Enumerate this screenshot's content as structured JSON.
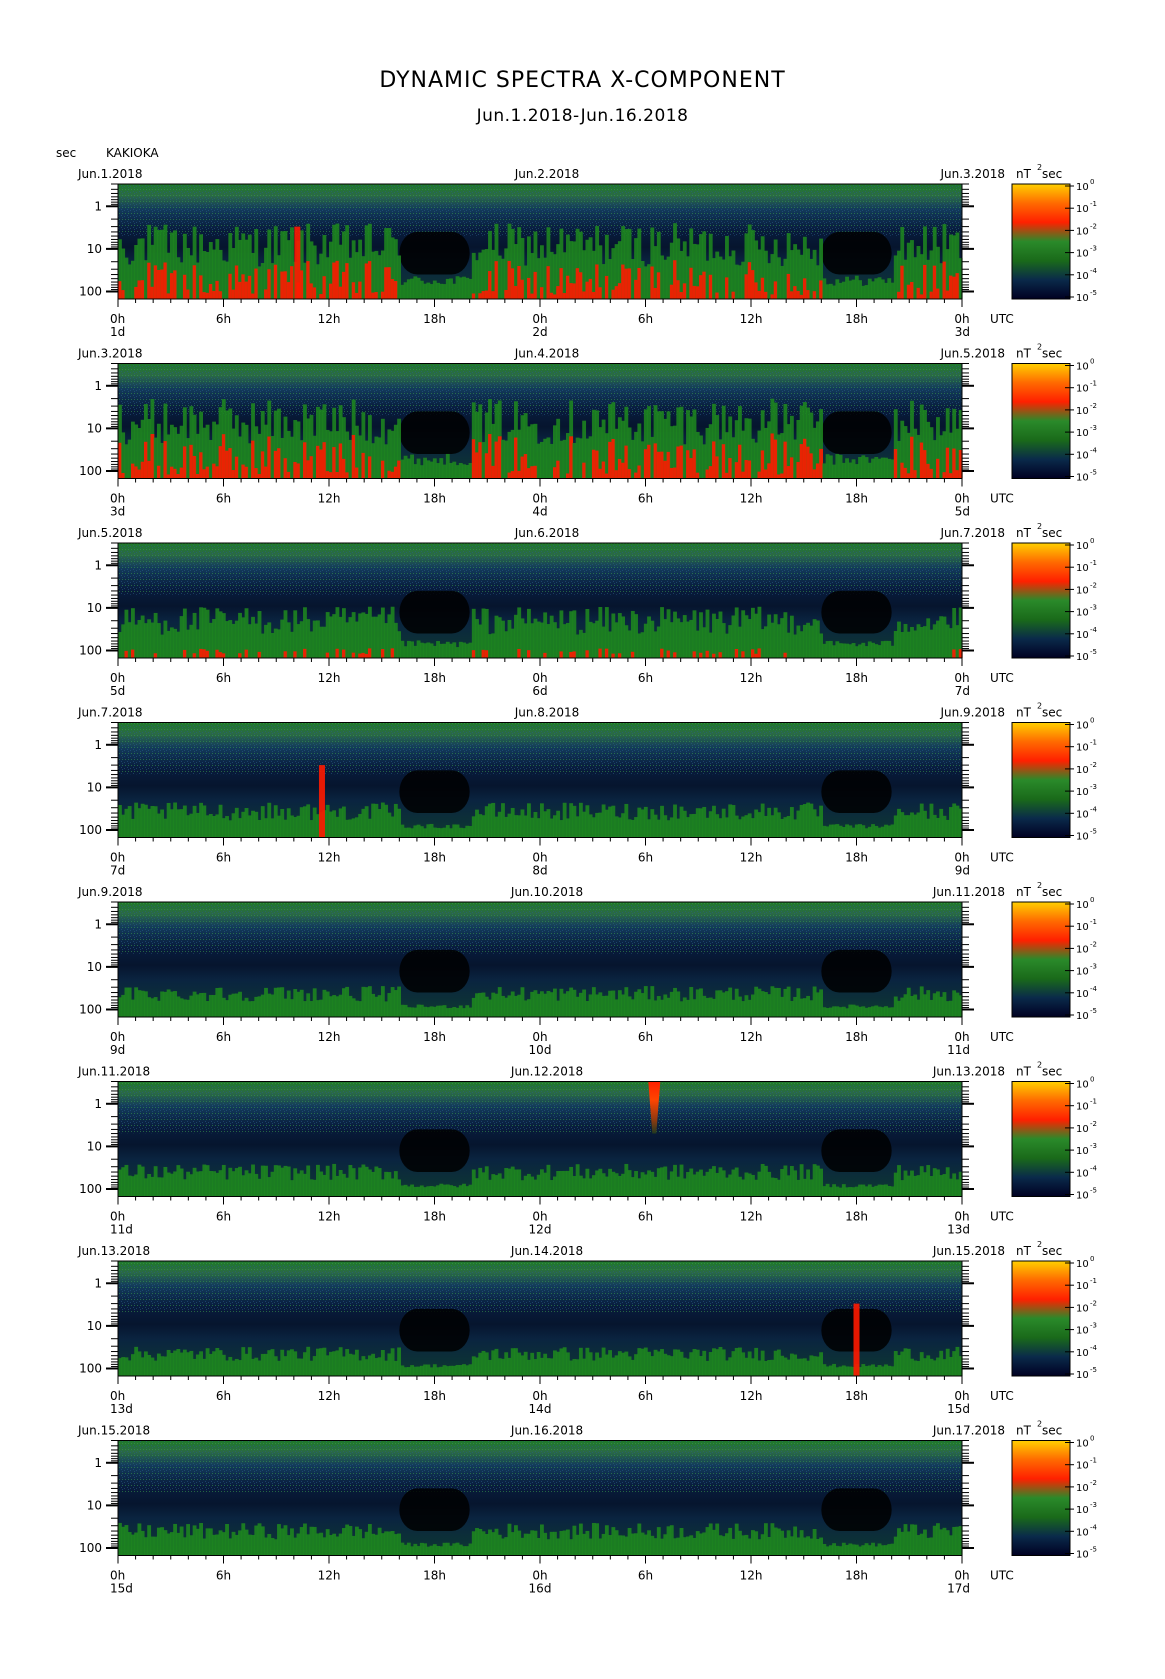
{
  "header": {
    "title": "DYNAMIC SPECTRA X-COMPONENT",
    "subtitle": "Jun.1.2018-Jun.16.2018",
    "unit": "sec",
    "station": "KAKIOKA"
  },
  "colors": {
    "noise_low": "#000820",
    "background_dark": "#000000",
    "green": "#1f8a1f",
    "red": "#ff1a00",
    "yellow": "#ffd700",
    "colorbar": [
      "#000022",
      "#0a2a4a",
      "#1a6a1a",
      "#2a8a2a",
      "#ff2000",
      "#ff6a00",
      "#ffd000"
    ]
  },
  "chart_data": {
    "type": "heatmap",
    "title": "DYNAMIC SPECTRA X-COMPONENT",
    "subtitle": "Jun.1.2018-Jun.16.2018",
    "ylabel": "sec",
    "y_axis": {
      "scale": "log",
      "range": [
        0.3,
        150
      ],
      "tick_labels": [
        "1",
        "10",
        "100"
      ]
    },
    "x_tick_labels": [
      "0h",
      "6h",
      "12h",
      "18h",
      "0h",
      "6h",
      "12h",
      "18h",
      "0h"
    ],
    "time_zone": "UTC",
    "colorbar": {
      "unit": "nT",
      "unit_exponent": "2",
      "unit_suffix": "sec",
      "scale": "log",
      "range": [
        1e-05,
        1
      ],
      "tick_labels": [
        "10",
        "10",
        "10",
        "10",
        "10",
        "10"
      ],
      "tick_exponents": [
        "0",
        "-1",
        "-2",
        "-3",
        "-4",
        "-5"
      ]
    },
    "panels": [
      {
        "left_date": "Jun.1.2018",
        "mid_date": "Jun.2.2018",
        "right_date": "Jun.3.2018",
        "day_labels": [
          "1d",
          "2d",
          "3d"
        ],
        "activity": 0.85,
        "spikes": [
          [
            10.2,
            0.6
          ]
        ],
        "pulses": []
      },
      {
        "left_date": "Jun.3.2018",
        "mid_date": "Jun.4.2018",
        "right_date": "Jun.5.2018",
        "day_labels": [
          "3d",
          "4d",
          "5d"
        ],
        "activity": 0.9,
        "spikes": [],
        "pulses": []
      },
      {
        "left_date": "Jun.5.2018",
        "mid_date": "Jun.6.2018",
        "right_date": "Jun.7.2018",
        "day_labels": [
          "5d",
          "6d",
          "7d"
        ],
        "activity": 0.55,
        "spikes": [],
        "pulses": []
      },
      {
        "left_date": "Jun.7.2018",
        "mid_date": "Jun.8.2018",
        "right_date": "Jun.9.2018",
        "day_labels": [
          "7d",
          "8d",
          "9d"
        ],
        "activity": 0.35,
        "spikes": [
          [
            11.6,
            0.4
          ]
        ],
        "pulses": []
      },
      {
        "left_date": "Jun.9.2018",
        "mid_date": "Jun.10.2018",
        "right_date": "Jun.11.2018",
        "day_labels": [
          "9d",
          "10d",
          "11d"
        ],
        "activity": 0.3,
        "spikes": [],
        "pulses": []
      },
      {
        "left_date": "Jun.11.2018",
        "mid_date": "Jun.12.2018",
        "right_date": "Jun.13.2018",
        "day_labels": [
          "11d",
          "12d",
          "13d"
        ],
        "activity": 0.32,
        "spikes": [],
        "pulses": [
          [
            30.5,
            1.0
          ]
        ]
      },
      {
        "left_date": "Jun.13.2018",
        "mid_date": "Jun.14.2018",
        "right_date": "Jun.15.2018",
        "day_labels": [
          "13d",
          "14d",
          "15d"
        ],
        "activity": 0.28,
        "spikes": [
          [
            42.0,
            0.4
          ]
        ],
        "pulses": []
      },
      {
        "left_date": "Jun.15.2018",
        "mid_date": "Jun.16.2018",
        "right_date": "Jun.17.2018",
        "day_labels": [
          "15d",
          "16d",
          "17d"
        ],
        "activity": 0.32,
        "spikes": [],
        "pulses": []
      }
    ],
    "quiet_windows_hours": [
      [
        16,
        20
      ],
      [
        40,
        44
      ]
    ]
  }
}
